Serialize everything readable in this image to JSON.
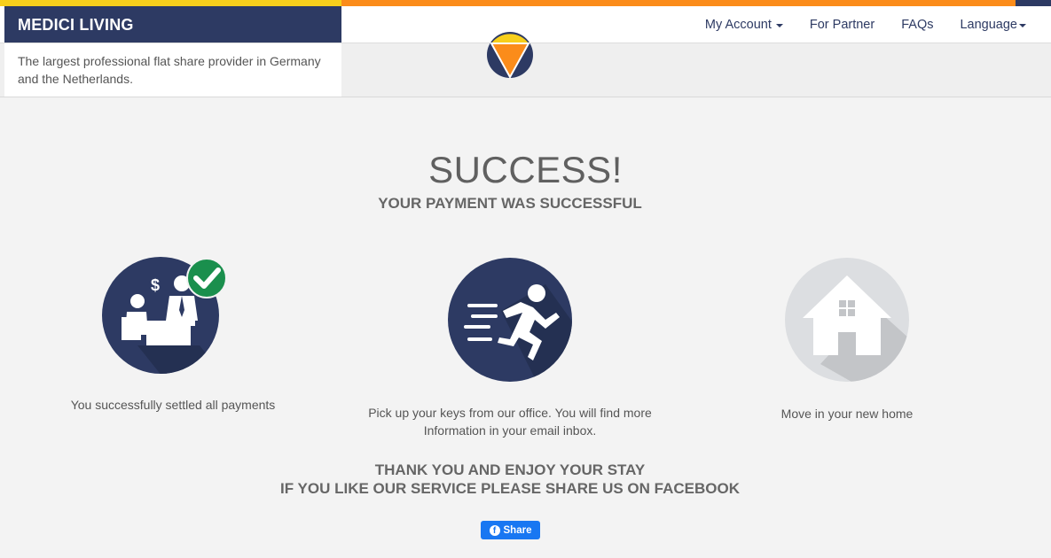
{
  "colors": {
    "brand_navy": "#2d3a63",
    "accent_yellow": "#f7cf1b",
    "accent_orange": "#fb8c1a",
    "success_green": "#1a8f4d",
    "facebook_blue": "#1877f2",
    "house_gray": "#dcdee1"
  },
  "header": {
    "brand": "MEDICI LIVING",
    "tagline": "The largest professional flat share provider in Germany and the Netherlands.",
    "nav": {
      "my_account": "My Account",
      "for_partner": "For Partner",
      "faqs": "FAQs",
      "language": "Language"
    }
  },
  "main": {
    "title": "SUCCESS!",
    "subtitle": "YOUR PAYMENT WAS SUCCESSFUL",
    "steps": [
      {
        "icon": "payment-meeting-icon",
        "text": "You successfully settled all payments"
      },
      {
        "icon": "running-person-icon",
        "text": "Pick up your keys from our office. You will find more Information in your email inbox."
      },
      {
        "icon": "house-icon",
        "text": "Move in your new home"
      }
    ],
    "thanks_line1": "THANK YOU AND ENJOY YOUR STAY",
    "thanks_line2": "IF YOU LIKE OUR SERVICE PLEASE SHARE US ON FACEBOOK",
    "share_button": "Share"
  }
}
